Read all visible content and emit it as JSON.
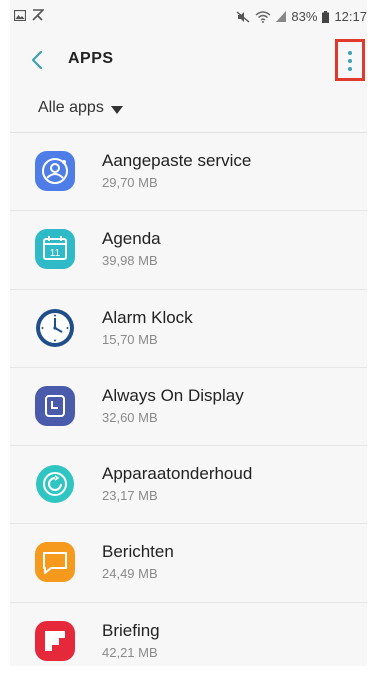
{
  "statusbar": {
    "battery": "83%",
    "time": "12:17"
  },
  "header": {
    "title": "APPS"
  },
  "filter": {
    "label": "Alle apps"
  },
  "apps": [
    {
      "name": "Aangepaste service",
      "size": "29,70 MB"
    },
    {
      "name": "Agenda",
      "size": "39,98 MB"
    },
    {
      "name": "Alarm Klock",
      "size": "15,70 MB"
    },
    {
      "name": "Always On Display",
      "size": "32,60 MB"
    },
    {
      "name": "Apparaatonderhoud",
      "size": "23,17 MB"
    },
    {
      "name": "Berichten",
      "size": "24,49 MB"
    },
    {
      "name": "Briefing",
      "size": "42,21 MB"
    }
  ],
  "agenda_icon_day": "11"
}
